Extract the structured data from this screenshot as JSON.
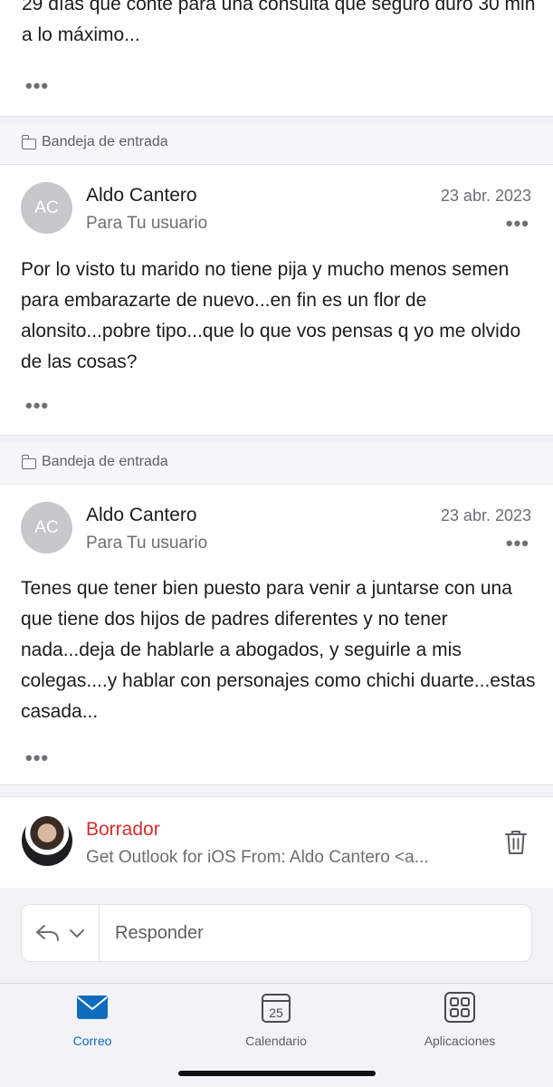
{
  "previous_message": {
    "body_tail": "29 días que conté para una consulta que seguro duró 30 min a lo máximo..."
  },
  "folder_label": "Bandeja de entrada",
  "messages": [
    {
      "avatar_initials": "AC",
      "sender": "Aldo Cantero",
      "recipient": "Para Tu usuario",
      "date": "23 abr. 2023",
      "body": "Por lo visto tu marido no tiene pija y mucho menos semen para embarazarte de nuevo...en fin es un flor de alonsito...pobre tipo...que lo que vos pensas q yo me olvido de las cosas?"
    },
    {
      "avatar_initials": "AC",
      "sender": "Aldo Cantero",
      "recipient": "Para Tu usuario",
      "date": "23 abr. 2023",
      "body": "Tenes que tener bien puesto para venir a juntarse con una que tiene dos hijos de padres diferentes y no tener nada...deja de hablarle a abogados, y seguirle a mis colegas....y hablar con personajes como chichi duarte...estas casada..."
    }
  ],
  "draft": {
    "title": "Borrador",
    "preview": "Get Outlook for iOS From: Aldo Cantero <a..."
  },
  "reply": {
    "placeholder": "Responder"
  },
  "tabs": [
    {
      "label": "Correo",
      "icon": "mail-icon",
      "active": true
    },
    {
      "label": "Calendario",
      "icon": "calendar-icon",
      "calendar_day": "25",
      "active": false
    },
    {
      "label": "Aplicaciones",
      "icon": "apps-icon",
      "active": false
    }
  ],
  "colors": {
    "accent": "#0f6cbd",
    "draft_red": "#d0312d",
    "avatar_gray": "#c7c7cc"
  }
}
